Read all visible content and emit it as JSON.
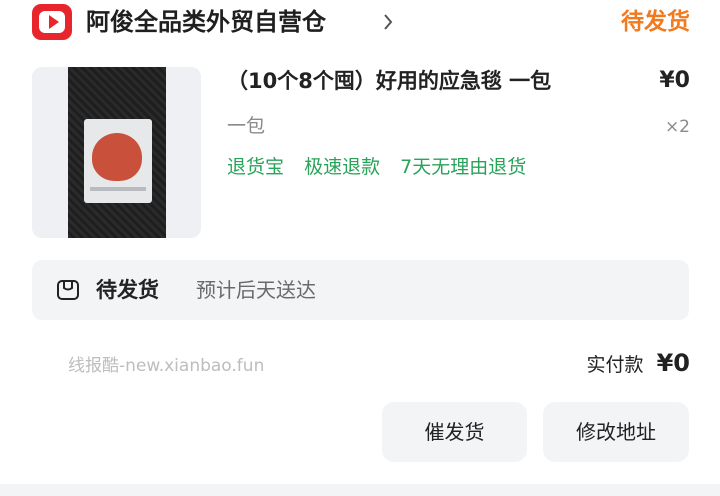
{
  "shop": {
    "name": "阿俊全品类外贸自营仓",
    "logo_icon": "video-play-logo-icon",
    "chevron_icon": "chevron-right-icon"
  },
  "order": {
    "status": "待发货",
    "status_color": "#f17a1f"
  },
  "product": {
    "title": "（10个8个囤）好用的应急毯 一包",
    "price": "¥0",
    "spec": "一包",
    "quantity": "×2",
    "service_tags": [
      "退货宝",
      "极速退款",
      "7天无理由退货"
    ],
    "service_tag_color": "#2aa35a"
  },
  "shipping": {
    "icon": "package-box-icon",
    "status": "待发货",
    "eta": "预计后天送达"
  },
  "watermark": "线报酷-new.xianbao.fun",
  "payment": {
    "label": "实付款",
    "amount": "¥0"
  },
  "actions": {
    "urge_label": "催发货",
    "change_address_label": "修改地址"
  }
}
